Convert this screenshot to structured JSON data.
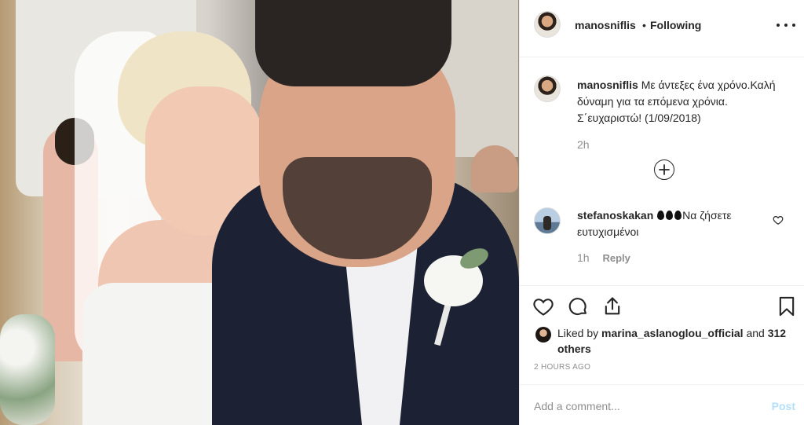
{
  "post": {
    "username": "manosniflis",
    "separator": "•",
    "follow_status": "Following"
  },
  "caption": {
    "username": "manosniflis",
    "text": "Με άντεξες ένα χρόνο.Καλή δύναμη για τα επόμενα χρόνια. Σ΄ευχαριστώ! (1/09/2018)",
    "time": "2h"
  },
  "comment": {
    "username": "stefanoskakan",
    "emoji_count": 3,
    "text": "Να ζήσετε ευτυχισμένοι",
    "time": "1h",
    "reply_label": "Reply"
  },
  "likes": {
    "prefix": "Liked by",
    "user": "marina_aslanoglou_official",
    "and": "and",
    "others": "312 others"
  },
  "timestamp": "2 HOURS AGO",
  "add_comment": {
    "placeholder": "Add a comment...",
    "post_label": "Post"
  },
  "colors": {
    "text": "#262626",
    "muted": "#8e8e8e",
    "post_disabled": "#b2dffc",
    "border": "#efefef"
  },
  "icons": [
    "more-icon",
    "load-more-icon",
    "heart-icon",
    "comment-icon",
    "share-icon",
    "bookmark-icon"
  ]
}
